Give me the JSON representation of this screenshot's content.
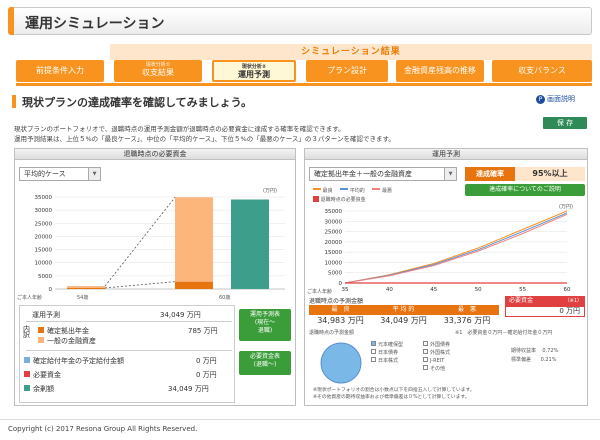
{
  "title": "運用シミュレーション",
  "sim_result_label": "シミュレーション結果",
  "steps": [
    {
      "label": "前提条件入力"
    },
    {
      "small": "現状分析①",
      "label": "収支結果"
    },
    {
      "small": "現状分析②",
      "label": "運用予測"
    },
    {
      "label": "プラン設計"
    },
    {
      "label": "金融資産残高の推移"
    },
    {
      "label": "収支バランス"
    }
  ],
  "heading": "現状プランの達成確率を確認してみましょう。",
  "help_label": "画面説明",
  "save_label": "保 存",
  "desc_line1": "現状プランのポートフォリオで、退職時点の運用予測金額が退職時点の必要資金に達成する確率を確認できます。",
  "desc_line2": "運用予測結果は、上位５%の「最良ケース」、中位の「平均的ケース」、下位５%の「最悪のケース」の３パターンを確認できます。",
  "left": {
    "title": "退職時点の必要資金",
    "case_select": "平均的ケース",
    "unit": "(万円)",
    "age_label": "ご本人年齢",
    "age_start": "54歳",
    "age_end": "60歳",
    "rows": {
      "forecast_label": "運用予測",
      "forecast_value": "34,049 万円",
      "breakdown_label": "内訳",
      "dc_label": "確定拠出年金",
      "dc_value": "785 万円",
      "general_label": "一般の金融資産",
      "db_label": "確定給付年金の予定給付金額",
      "db_value": "0 万円",
      "need_label": "必要資金",
      "need_value": "0 万円",
      "surplus_label": "余剰額",
      "surplus_value": "34,049 万円"
    },
    "btn1_l1": "運用予測表",
    "btn1_l2": "(現在〜",
    "btn1_l3": "退職)",
    "btn2_l1": "必要資金表",
    "btn2_l2": "(退職〜)"
  },
  "right": {
    "title": "運用予測",
    "select": "確定拠出年金＋一般の金融資産",
    "rate_label": "達成確率",
    "rate_value": "95%以上",
    "rate_btn": "達成確率についてのご説明",
    "unit": "(万円)",
    "legend": {
      "best": "最良",
      "avg": "平均的",
      "worst": "最悪",
      "need": "退職時点の必要資金"
    },
    "age_label": "ご本人年齢",
    "ret_label": "退職時点の予測金額",
    "cols": {
      "best": "最　良",
      "avg": "平 均 的",
      "worst": "最　悪"
    },
    "vals": {
      "best": "34,983 万円",
      "avg": "34,049 万円",
      "worst": "33,376 万円"
    },
    "need_col": "必要資金",
    "need_note": "（※1）",
    "need_val": "0 万円",
    "alloc_label": "退職時点の予測金額",
    "alloc_note": "※1　必要資金０万円－確定給付年金０万円",
    "assets": [
      "元本確保型",
      "日本債券",
      "日本株式",
      "外国債券",
      "外国株式",
      "J-REIT",
      "その他"
    ],
    "exp_return_label": "期待収益率",
    "exp_return": "0.72%",
    "std_label": "標準偏差",
    "std": "0.21%",
    "foot1": "※現状ポートフォリオの割合は小数点以下を四捨五入して計算しています。",
    "foot2": "※その他資産の期待収益率および標準偏差は０%として計算しています。"
  },
  "colors": {
    "orange": "#f7931e",
    "dark_orange": "#e8740f",
    "light_orange": "#fcb57a",
    "teal": "#3d9e8c",
    "blue": "#5a8fd0",
    "red": "#e04040",
    "pink": "#f08080",
    "green": "#3a9d3a"
  },
  "chart_data": [
    {
      "type": "bar",
      "title": "退職時点の必要資金",
      "ylim": [
        0,
        35000
      ],
      "yticks": [
        0,
        5000,
        10000,
        15000,
        20000,
        25000,
        30000,
        35000
      ],
      "categories": [
        "54歳",
        "60歳"
      ],
      "series": [
        {
          "name": "確定拠出年金",
          "values": [
            400,
            2800
          ]
        },
        {
          "name": "一般の金融資産",
          "values": [
            700,
            32100
          ]
        },
        {
          "name": "余剰額",
          "values": [
            null,
            34049
          ]
        }
      ]
    },
    {
      "type": "line",
      "title": "運用予測",
      "ylim": [
        0,
        35000
      ],
      "yticks": [
        0,
        5000,
        10000,
        15000,
        20000,
        25000,
        30000,
        35000
      ],
      "xticks": [
        35,
        40,
        45,
        50,
        55,
        60
      ],
      "series": [
        {
          "name": "最良",
          "x": [
            35,
            40,
            45,
            50,
            55,
            60
          ],
          "values": [
            0,
            4000,
            9500,
            17000,
            26000,
            35000
          ]
        },
        {
          "name": "平均的",
          "x": [
            35,
            40,
            45,
            50,
            55,
            60
          ],
          "values": [
            0,
            3800,
            9000,
            16200,
            25000,
            34049
          ]
        },
        {
          "name": "最悪",
          "x": [
            35,
            40,
            45,
            50,
            55,
            60
          ],
          "values": [
            0,
            3500,
            8500,
            15500,
            24000,
            33376
          ]
        },
        {
          "name": "退職時点の必要資金",
          "x": [
            35,
            40,
            45,
            50,
            55,
            60
          ],
          "values": [
            0,
            0,
            0,
            0,
            0,
            0
          ]
        }
      ]
    }
  ]
}
